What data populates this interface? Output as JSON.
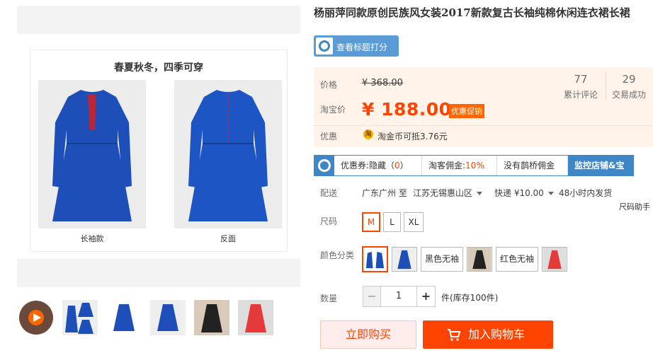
{
  "gallery": {
    "caption": "春夏秋冬，四季可穿",
    "label_left": "长袖款",
    "label_right": "反面"
  },
  "product": {
    "title": "杨丽萍同款原创民族风女装2017新款复古长袖纯棉休闲连衣裙长裙",
    "score_button": "查看标题打分"
  },
  "price": {
    "price_label": "价格",
    "original": "¥ 368.00",
    "taobao_label": "淘宝价",
    "current": "¥ 188.00",
    "promo_tag": "优惠促销",
    "discount_label": "优惠",
    "coin_text": "淘金币可抵3.76元",
    "reviews_count": "77",
    "reviews_label": "累计评论",
    "sales_count": "29",
    "sales_label": "交易成功"
  },
  "promo_bar": {
    "coupon_prefix": "优惠券:隐藏（",
    "coupon_value": "0",
    "coupon_suffix": "）",
    "commission_prefix": "淘客佣金:",
    "commission_value": "10%",
    "bridge": "没有鹊桥佣金",
    "monitor": "监控店铺&宝贝"
  },
  "shipping": {
    "label": "配送",
    "from": "广东广州 至",
    "to": "江苏无锡惠山区",
    "express": "快递 ¥10.00",
    "dispatch": "48小时内发货"
  },
  "size": {
    "label": "尺码",
    "help": "尺码助手",
    "options": [
      "M",
      "L",
      "XL"
    ],
    "selected": "M"
  },
  "color": {
    "label": "颜色分类",
    "text_options": [
      "黑色无袖",
      "红色无袖"
    ]
  },
  "quantity": {
    "label": "数量",
    "minus": "−",
    "plus": "+",
    "value": "1",
    "stock": "件(库存100件)"
  },
  "actions": {
    "buy_now": "立即购买",
    "add_cart": "加入购物车"
  },
  "colors": {
    "accent": "#ff4400",
    "promo_blue": "#3f86c6",
    "price_bg": "#fff3ea"
  }
}
